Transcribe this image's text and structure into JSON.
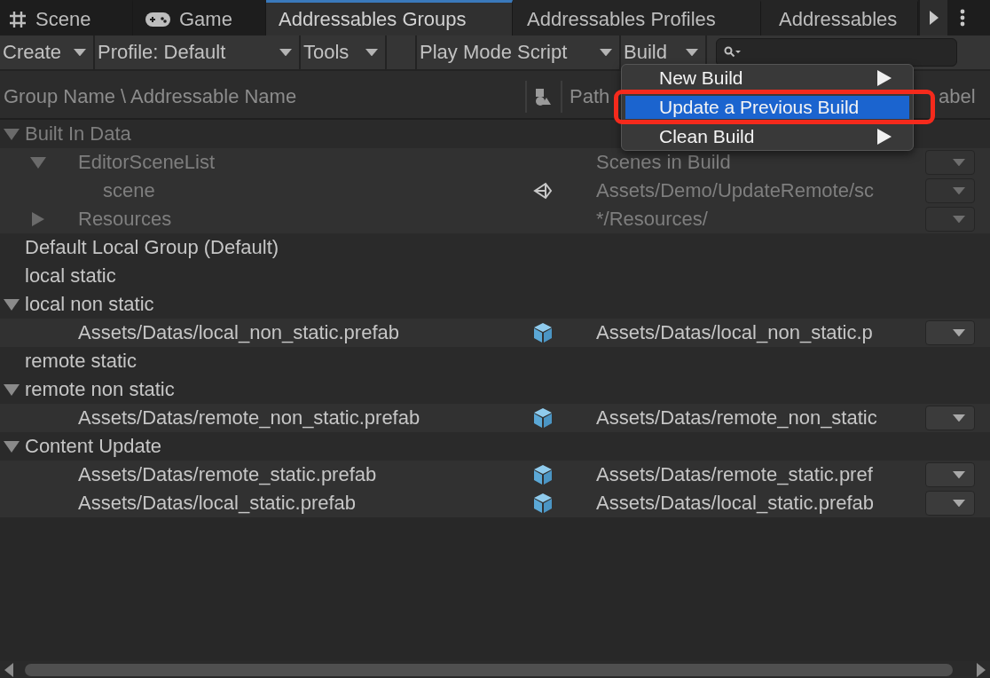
{
  "tabs": [
    {
      "label": "Scene",
      "kind": "scene",
      "selected": false
    },
    {
      "label": "Game",
      "kind": "game",
      "selected": false
    },
    {
      "label": "Addressables Groups",
      "kind": "plain",
      "selected": true
    },
    {
      "label": "Addressables Profiles",
      "kind": "plain",
      "selected": false
    },
    {
      "label": "Addressables",
      "kind": "plain",
      "selected": false
    }
  ],
  "toolbar": [
    {
      "kind": "button",
      "label": "Create"
    },
    {
      "kind": "button",
      "label": "Profile: Default"
    },
    {
      "kind": "button",
      "label": "Tools"
    },
    {
      "kind": "spacer"
    },
    {
      "kind": "button",
      "label": "Play Mode Script"
    },
    {
      "kind": "button",
      "label": "Build"
    },
    {
      "kind": "search"
    }
  ],
  "columns": [
    {
      "kind": "text",
      "label": "Group Name \\ Addressable Name"
    },
    {
      "kind": "icon"
    },
    {
      "kind": "text",
      "label": "Path"
    },
    {
      "kind": "text",
      "label": "abel"
    }
  ],
  "groups": [
    {
      "name": "Built In Data",
      "kind": "group",
      "disabled": true,
      "expanded": true,
      "children": [
        {
          "name": "EditorSceneList",
          "kind": "folder",
          "disabled": true,
          "expanded": true,
          "path": "Scenes in Build",
          "children": [
            {
              "name": "scene",
              "kind": "scene",
              "disabled": true,
              "path": "Assets/Demo/UpdateRemote/sc"
            }
          ]
        },
        {
          "name": "Resources",
          "kind": "folder",
          "disabled": true,
          "expanded": false,
          "path": "*/Resources/"
        }
      ]
    },
    {
      "name": "Default Local Group (Default)",
      "kind": "group",
      "disabled": false
    },
    {
      "name": "local static",
      "kind": "group",
      "disabled": false
    },
    {
      "name": "local non static",
      "kind": "group",
      "disabled": false,
      "expanded": true,
      "children": [
        {
          "name": "Assets/Datas/local_non_static.prefab",
          "kind": "prefab",
          "disabled": false,
          "path": "Assets/Datas/local_non_static.p"
        }
      ]
    },
    {
      "name": "remote static",
      "kind": "group",
      "disabled": false
    },
    {
      "name": "remote non static",
      "kind": "group",
      "disabled": false,
      "expanded": true,
      "children": [
        {
          "name": "Assets/Datas/remote_non_static.prefab",
          "kind": "prefab",
          "disabled": false,
          "path": "Assets/Datas/remote_non_static"
        }
      ]
    },
    {
      "name": "Content Update",
      "kind": "group",
      "disabled": false,
      "expanded": true,
      "children": [
        {
          "name": "Assets/Datas/remote_static.prefab",
          "kind": "prefab",
          "disabled": false,
          "path": "Assets/Datas/remote_static.pref"
        },
        {
          "name": "Assets/Datas/local_static.prefab",
          "kind": "prefab",
          "disabled": false,
          "path": "Assets/Datas/local_static.prefab"
        }
      ]
    }
  ],
  "build_menu": [
    {
      "label": "New Build",
      "selected": false,
      "submenu": true,
      "highlighted": false
    },
    {
      "label": "Update a Previous Build",
      "selected": true,
      "submenu": false,
      "highlighted": true
    },
    {
      "label": "Clean Build",
      "selected": false,
      "submenu": true,
      "highlighted": false
    }
  ]
}
